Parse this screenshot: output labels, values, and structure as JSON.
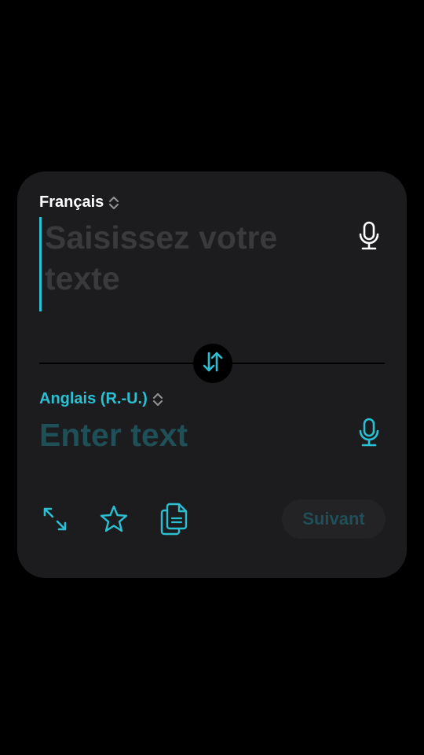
{
  "source": {
    "language_label": "Français",
    "placeholder": "Saisissez votre texte",
    "mic_icon": "microphone-icon"
  },
  "target": {
    "language_label": "Anglais (R.-U.)",
    "placeholder": "Enter text",
    "mic_icon": "microphone-icon"
  },
  "swap_icon": "swap-arrows-icon",
  "toolbar": {
    "icons": [
      "expand-icon",
      "star-icon",
      "copy-icon"
    ],
    "next_label": "Suivant"
  },
  "colors": {
    "accent": "#2bbfd2",
    "card_background": "#1c1c1e",
    "page_background": "#000000",
    "placeholder_source": "#3a3a3d",
    "placeholder_target": "#1f4f57"
  }
}
